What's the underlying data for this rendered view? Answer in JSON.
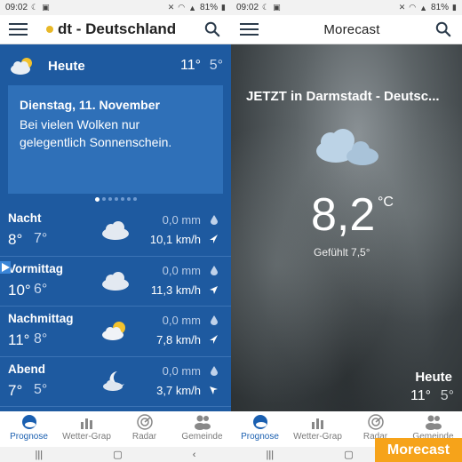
{
  "left": {
    "status": {
      "time": "09:02",
      "battery": "81%"
    },
    "appbar": {
      "title": "dt - Deutschland"
    },
    "today": {
      "label": "Heute",
      "high": "11°",
      "low": "5°"
    },
    "card": {
      "date": "Dienstag, 11. November",
      "text_line1": "Bei vielen Wolken nur",
      "text_line2": "gelegentlich Sonnenschein."
    },
    "periods": [
      {
        "name": "Nacht",
        "high": "8°",
        "low": "7°",
        "rain": "0,0 mm",
        "wind": "10,1 km/h",
        "icon": "cloud-icon"
      },
      {
        "name": "Vormittag",
        "high": "10°",
        "low": "6°",
        "rain": "0,0 mm",
        "wind": "11,3 km/h",
        "icon": "cloud-icon"
      },
      {
        "name": "Nachmittag",
        "high": "11°",
        "low": "8°",
        "rain": "0,0 mm",
        "wind": "7,8 km/h",
        "icon": "sun-cloud-icon"
      },
      {
        "name": "Abend",
        "high": "7°",
        "low": "5°",
        "rain": "0,0 mm",
        "wind": "3,7 km/h",
        "icon": "moon-cloud-icon"
      }
    ],
    "tabs": [
      "Prognose",
      "Wetter-Grap",
      "Radar",
      "Gemeinde"
    ]
  },
  "right": {
    "status": {
      "time": "09:02",
      "battery": "81%"
    },
    "appbar": {
      "title": "Morecast"
    },
    "location_title": "JETZT in Darmstadt - Deutsc...",
    "temperature": "8,2",
    "unit": "°C",
    "feels_like": "Gefühlt 7,5°",
    "today": {
      "label": "Heute",
      "high": "11°",
      "low": "5°"
    },
    "tabs": [
      "Prognose",
      "Wetter-Grap",
      "Radar",
      "Gemeinde"
    ],
    "brand": "Morecast"
  },
  "colors": {
    "primary_blue": "#1e5aa0",
    "card_blue": "#2f70b8",
    "accent_orange": "#f6a31a",
    "tab_active": "#1a5fb0"
  }
}
